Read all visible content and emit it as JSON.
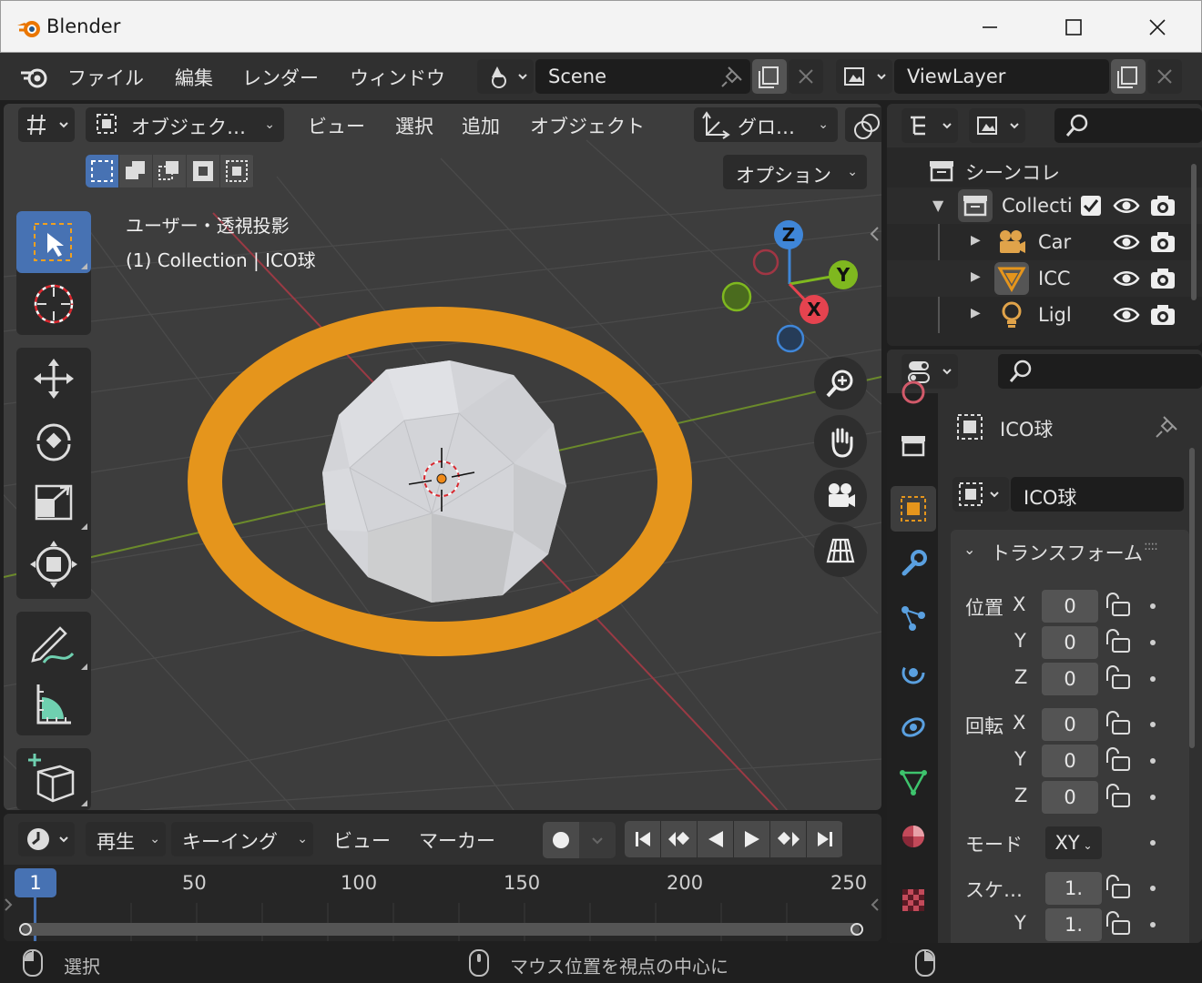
{
  "window": {
    "title": "Blender"
  },
  "menubar": {
    "items": [
      "ファイル",
      "編集",
      "レンダー",
      "ウィンドウ"
    ],
    "scene": "Scene",
    "view_layer": "ViewLayer"
  },
  "viewport": {
    "mode": "オブジェク…",
    "menus": [
      "ビュー",
      "選択",
      "追加",
      "オブジェクト"
    ],
    "transform_orientation": "グロ…",
    "options": "オプション",
    "info_line1": "ユーザー・透視投影",
    "info_line2": "(1) Collection | ICO球",
    "gizmo": {
      "x": "X",
      "y": "Y",
      "z": "Z"
    }
  },
  "timeline": {
    "menus": [
      "再生",
      "キーイング",
      "ビュー",
      "マーカー"
    ],
    "current_frame": "1",
    "ruler": [
      "50",
      "100",
      "150",
      "200",
      "250"
    ]
  },
  "outliner": {
    "scene_collection": "シーンコレ…",
    "collection": "Collecti",
    "items": [
      "Car",
      "ICC",
      "Ligl"
    ]
  },
  "properties": {
    "object_name": "ICO球",
    "object_field": "ICO球",
    "transform_panel": "トランスフォーム",
    "location_label": "位置",
    "rotation_label": "回転",
    "scale_label": "スケ…",
    "axis_x": "X",
    "axis_y": "Y",
    "axis_z": "Z",
    "location": [
      "0",
      "0",
      "0"
    ],
    "rotation": [
      "0",
      "0",
      "0"
    ],
    "mode_label": "モード",
    "mode_value": "XY",
    "scale": [
      "1.",
      "1."
    ]
  },
  "statusbar": {
    "left": "選択",
    "center": "マウス位置を視点の中心に"
  },
  "colors": {
    "accent": "#4772b3",
    "selection_outline": "#e5951c",
    "x_axis": "#e5434f",
    "y_axis": "#7fb81f",
    "z_axis": "#3f86d8"
  }
}
